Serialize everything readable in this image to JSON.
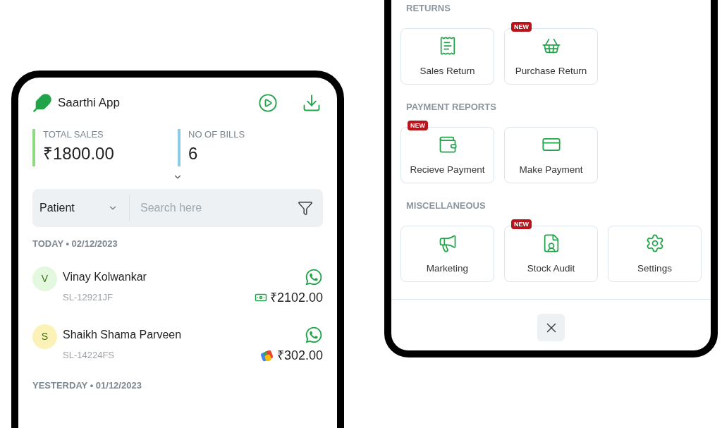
{
  "sales_app": {
    "title": "Saarthi App",
    "stats": [
      {
        "label": "TOTAL SALES",
        "value": "₹1800.00",
        "color": "#8fdc7e"
      },
      {
        "label": "NO OF BILLS",
        "value": "6",
        "color": "#8ccbe8"
      }
    ],
    "filter": {
      "value": "Patient"
    },
    "search": {
      "placeholder": "Search here"
    },
    "groups": [
      {
        "heading": "TODAY • 02/12/2023",
        "entries": [
          {
            "initial": "V",
            "color": "#e3f8de",
            "name": "Vinay Kolwankar",
            "bill": "SL-12921JF",
            "amount": "₹2102.00"
          },
          {
            "initial": "S",
            "color": "#fcf1b6",
            "name": "Shaikh Shama Parveen",
            "bill": "SL-14224FS",
            "amount": "₹302.00"
          }
        ]
      },
      {
        "heading": "YESTERDAY • 01/12/2023"
      }
    ]
  },
  "menu_sheet": {
    "sections": [
      {
        "heading": "RETURNS",
        "items": [
          {
            "label": "Sales Return"
          },
          {
            "label": "Purchase Return",
            "badge": "NEW"
          }
        ]
      },
      {
        "heading": "PAYMENT REPORTS",
        "items": [
          {
            "label": "Recieve Payment",
            "badge": "NEW"
          },
          {
            "label": "Make Payment"
          }
        ]
      },
      {
        "heading": "MISCELLANEOUS",
        "items": [
          {
            "label": "Marketing"
          },
          {
            "label": "Stock Audit",
            "badge": "NEW"
          },
          {
            "label": "Settings"
          }
        ]
      }
    ]
  }
}
